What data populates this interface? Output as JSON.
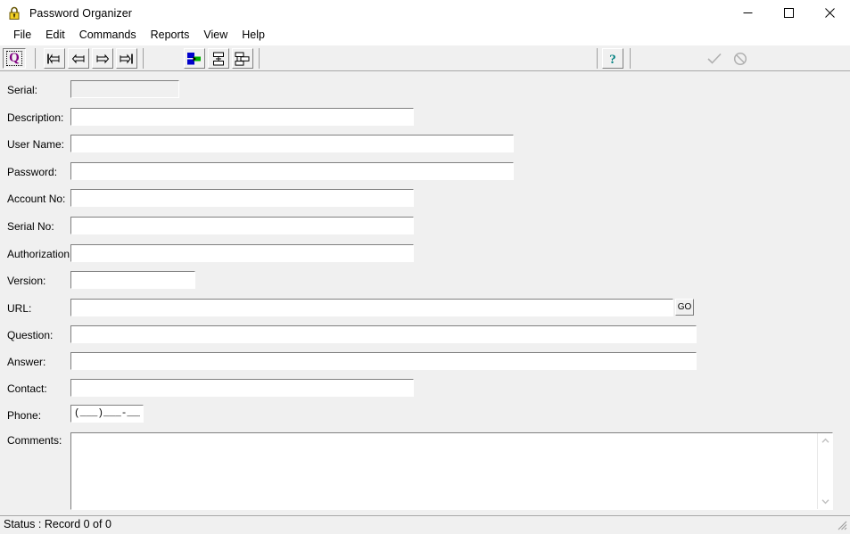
{
  "window": {
    "title": "Password Organizer",
    "icon": "padlock-icon",
    "controls": {
      "minimize": "minimize-icon",
      "maximize": "maximize-icon",
      "close": "close-icon"
    }
  },
  "menu": {
    "items": [
      {
        "label": "File"
      },
      {
        "label": "Edit"
      },
      {
        "label": "Commands"
      },
      {
        "label": "Reports"
      },
      {
        "label": "View"
      },
      {
        "label": "Help"
      }
    ]
  },
  "toolbar": {
    "logo": {
      "name": "app-logo-q-button",
      "text": "Q",
      "color": "#800080"
    },
    "buttons": [
      {
        "name": "first-record-button",
        "icon": "first-record-icon"
      },
      {
        "name": "previous-record-button",
        "icon": "previous-record-icon"
      },
      {
        "name": "next-record-button",
        "icon": "next-record-icon"
      },
      {
        "name": "last-record-button",
        "icon": "last-record-icon"
      },
      {
        "name": "database-link-button",
        "icon": "database-link-icon"
      },
      {
        "name": "split-records-button",
        "icon": "split-records-icon"
      },
      {
        "name": "merge-records-button",
        "icon": "merge-records-icon"
      },
      {
        "name": "help-button",
        "icon": "question-mark-icon"
      },
      {
        "name": "confirm-button",
        "icon": "checkmark-icon",
        "disabled": true
      },
      {
        "name": "cancel-button",
        "icon": "no-entry-icon",
        "disabled": true
      }
    ]
  },
  "form": {
    "fields": [
      {
        "label": "Serial:",
        "value": "",
        "disabled": true
      },
      {
        "label": "Description:",
        "value": ""
      },
      {
        "label": "User Name:",
        "value": ""
      },
      {
        "label": "Password:",
        "value": ""
      },
      {
        "label": "Account No:",
        "value": ""
      },
      {
        "label": "Serial No:",
        "value": ""
      },
      {
        "label": "Authorization:",
        "value": ""
      },
      {
        "label": "Version:",
        "value": ""
      },
      {
        "label": "URL:",
        "value": ""
      },
      {
        "label": "Question:",
        "value": ""
      },
      {
        "label": "Answer:",
        "value": ""
      },
      {
        "label": "Contact:",
        "value": ""
      },
      {
        "label": "Phone:",
        "value": "(___)___-____"
      },
      {
        "label": "Comments:",
        "value": ""
      }
    ],
    "go_button": "GO"
  },
  "status": {
    "text": "Status : Record 0 of 0"
  },
  "colors": {
    "background": "#f0f0f0",
    "field_background": "#ffffff",
    "logo_purple": "#800080",
    "help_teal": "#008080",
    "lock_yellow": "#f2d024"
  }
}
